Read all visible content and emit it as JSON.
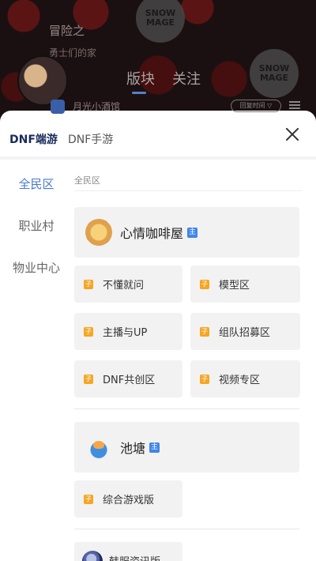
{
  "background": {
    "forum_title": "冒险之",
    "forum_sub": "勇士们的家",
    "logo_text": "SNOW\nMAGE",
    "tabs": [
      "版块",
      "关注"
    ],
    "user_name": "月光小酒馆",
    "pill_text": "回复时间 ▽"
  },
  "sheet": {
    "tabs": [
      {
        "label": "DNF端游",
        "active": true
      },
      {
        "label": "DNF手游",
        "active": false
      }
    ],
    "close_label": "×"
  },
  "left_nav": [
    {
      "label": "全民区",
      "active": true
    },
    {
      "label": "职业村",
      "active": false
    },
    {
      "label": "物业中心",
      "active": false
    }
  ],
  "content": {
    "section_label": "全民区",
    "main_tag": "主",
    "sub_tag": "子",
    "groups": [
      {
        "title": "心情咖啡屋",
        "icon": "cafe-icon",
        "subs": [
          "不懂就问",
          "模型区",
          "主播与UP",
          "组队招募区",
          "DNF共创区",
          "视频专区"
        ]
      },
      {
        "title": "池塘",
        "icon": "pond-icon",
        "subs": [
          "综合游戏版"
        ]
      }
    ],
    "news_board": "韩服资讯版"
  },
  "colors": {
    "accent": "#4a79c9",
    "main_tag": "#3f86e8",
    "sub_tag": "#f5a623",
    "card_bg": "#f2f2f2"
  }
}
